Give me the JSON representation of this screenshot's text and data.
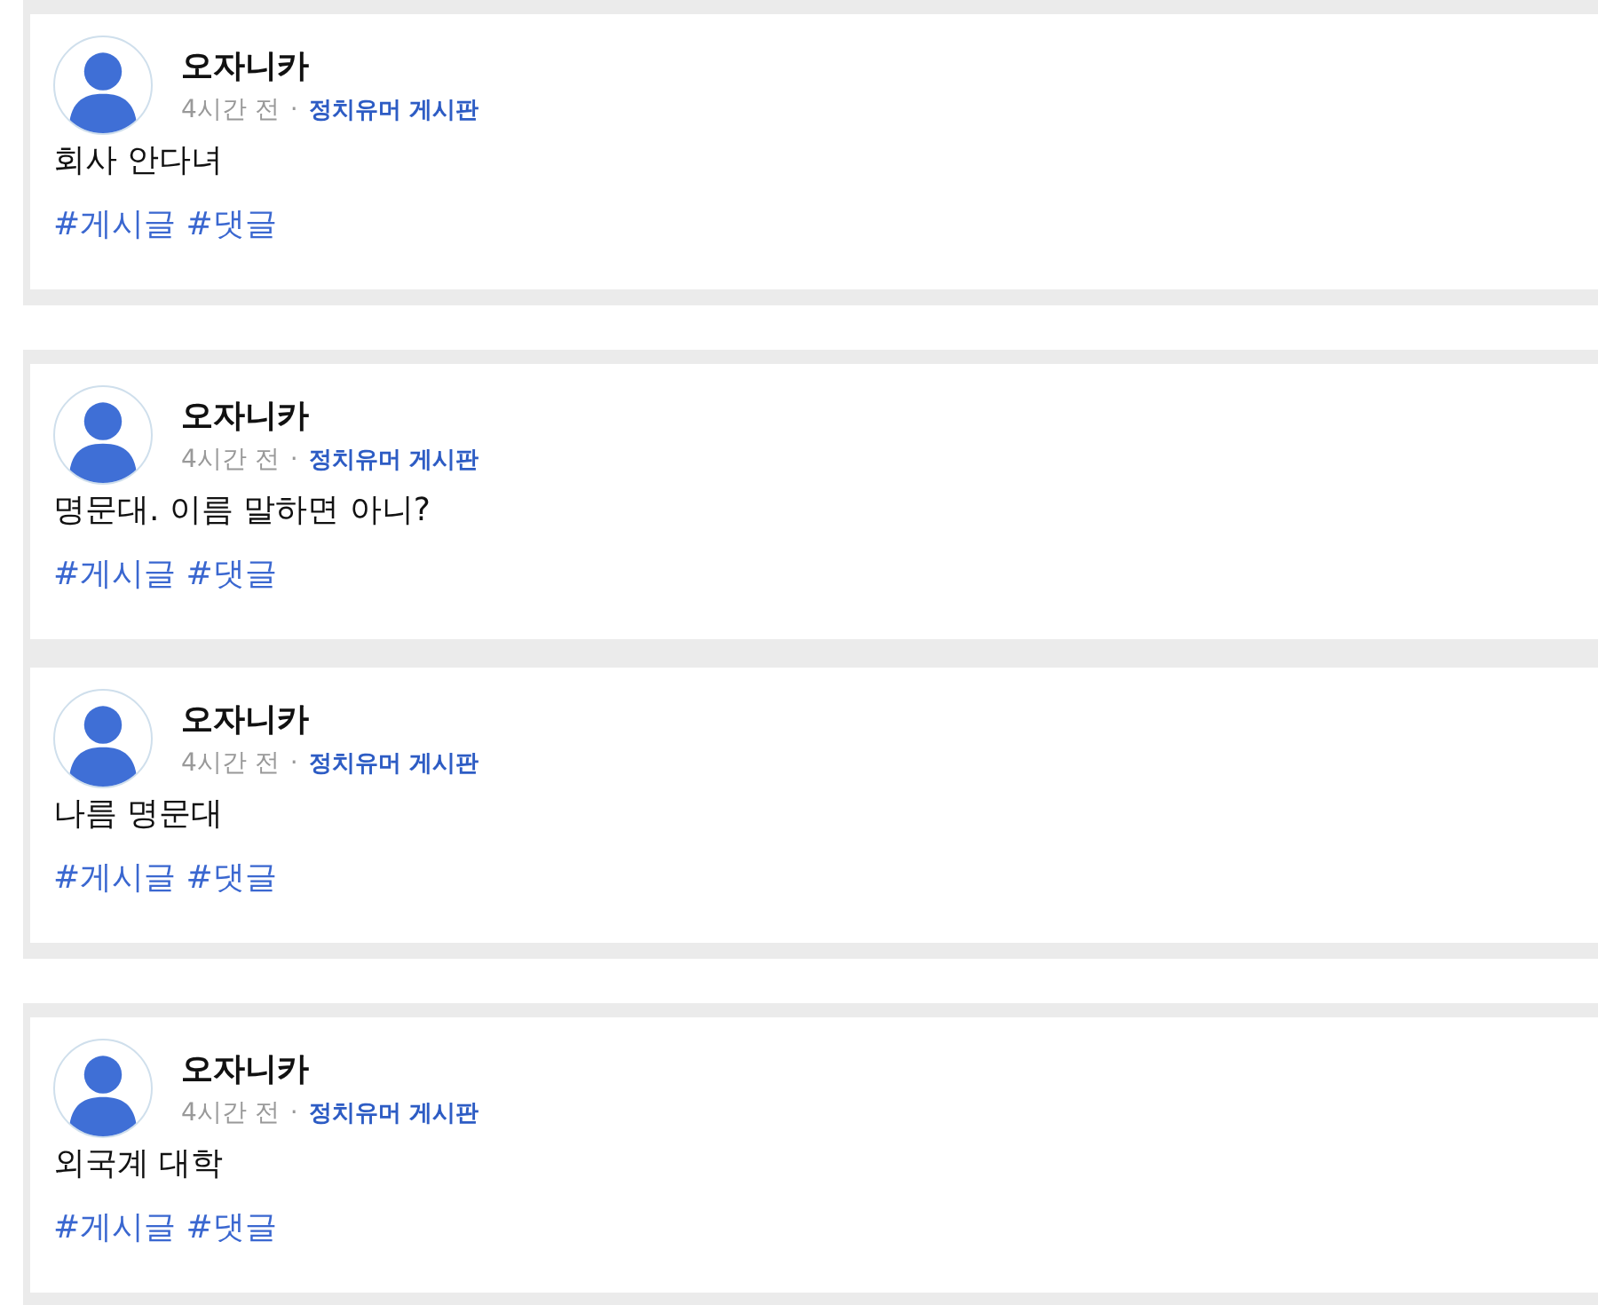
{
  "groups": [
    {
      "posts": [
        {
          "author": "오자니카",
          "time": "4시간 전",
          "separator": "·",
          "board": "정치유머 게시판",
          "text": "회사 안다녀",
          "tags": "#게시글 #댓글"
        }
      ]
    },
    {
      "posts": [
        {
          "author": "오자니카",
          "time": "4시간 전",
          "separator": "·",
          "board": "정치유머 게시판",
          "text": "명문대. 이름 말하면 아니?",
          "tags": "#게시글 #댓글"
        },
        {
          "author": "오자니카",
          "time": "4시간 전",
          "separator": "·",
          "board": "정치유머 게시판",
          "text": "나름 명문대",
          "tags": "#게시글 #댓글"
        }
      ]
    },
    {
      "posts": [
        {
          "author": "오자니카",
          "time": "4시간 전",
          "separator": "·",
          "board": "정치유머 게시판",
          "text": "외국계 대학",
          "tags": "#게시글 #댓글"
        }
      ]
    }
  ]
}
